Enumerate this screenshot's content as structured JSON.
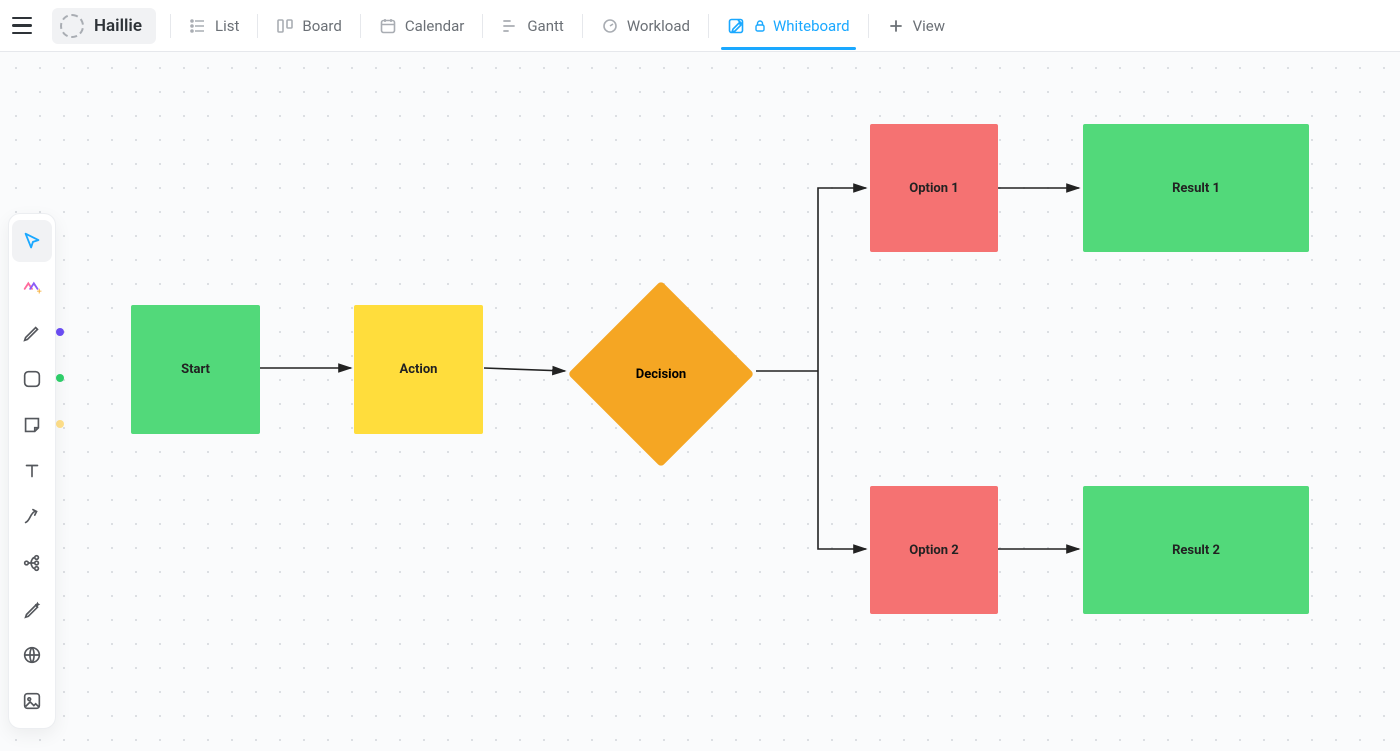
{
  "space": {
    "name": "Haillie"
  },
  "views": {
    "list": {
      "label": "List"
    },
    "board": {
      "label": "Board"
    },
    "calendar": {
      "label": "Calendar"
    },
    "gantt": {
      "label": "Gantt"
    },
    "workload": {
      "label": "Workload"
    },
    "whiteboard": {
      "label": "Whiteboard",
      "active": true,
      "locked": true
    },
    "add": {
      "label": "View"
    }
  },
  "toolbox": {
    "select": {
      "name": "select",
      "active": true
    },
    "ai": {
      "name": "ai"
    },
    "pen": {
      "name": "pen",
      "color": "#6c4ef5"
    },
    "shape": {
      "name": "shape",
      "color": "#2fd16b"
    },
    "sticky": {
      "name": "sticky",
      "color": "#ffe08a"
    },
    "text": {
      "name": "text"
    },
    "connector": {
      "name": "connector"
    },
    "mindmap": {
      "name": "mindmap"
    },
    "generate": {
      "name": "generate"
    },
    "website": {
      "name": "website"
    },
    "image": {
      "name": "image"
    }
  },
  "nodes": {
    "start": {
      "label": "Start",
      "color": "green"
    },
    "action": {
      "label": "Action",
      "color": "yellow"
    },
    "decision": {
      "label": "Decision",
      "color": "orange"
    },
    "option1": {
      "label": "Option 1",
      "color": "red"
    },
    "option2": {
      "label": "Option 2",
      "color": "red"
    },
    "result1": {
      "label": "Result 1",
      "color": "green"
    },
    "result2": {
      "label": "Result 2",
      "color": "green"
    }
  },
  "chart_data": {
    "type": "flowchart",
    "nodes": [
      {
        "id": "start",
        "label": "Start",
        "shape": "rect",
        "color": "#52d97a"
      },
      {
        "id": "action",
        "label": "Action",
        "shape": "rect",
        "color": "#ffdd3c"
      },
      {
        "id": "decision",
        "label": "Decision",
        "shape": "diamond",
        "color": "#f5a623"
      },
      {
        "id": "option1",
        "label": "Option 1",
        "shape": "rect",
        "color": "#f57272"
      },
      {
        "id": "option2",
        "label": "Option 2",
        "shape": "rect",
        "color": "#f57272"
      },
      {
        "id": "result1",
        "label": "Result 1",
        "shape": "rect",
        "color": "#52d97a"
      },
      {
        "id": "result2",
        "label": "Result 2",
        "shape": "rect",
        "color": "#52d97a"
      }
    ],
    "edges": [
      {
        "from": "start",
        "to": "action"
      },
      {
        "from": "action",
        "to": "decision"
      },
      {
        "from": "decision",
        "to": "option1"
      },
      {
        "from": "decision",
        "to": "option2"
      },
      {
        "from": "option1",
        "to": "result1"
      },
      {
        "from": "option2",
        "to": "result2"
      }
    ]
  }
}
